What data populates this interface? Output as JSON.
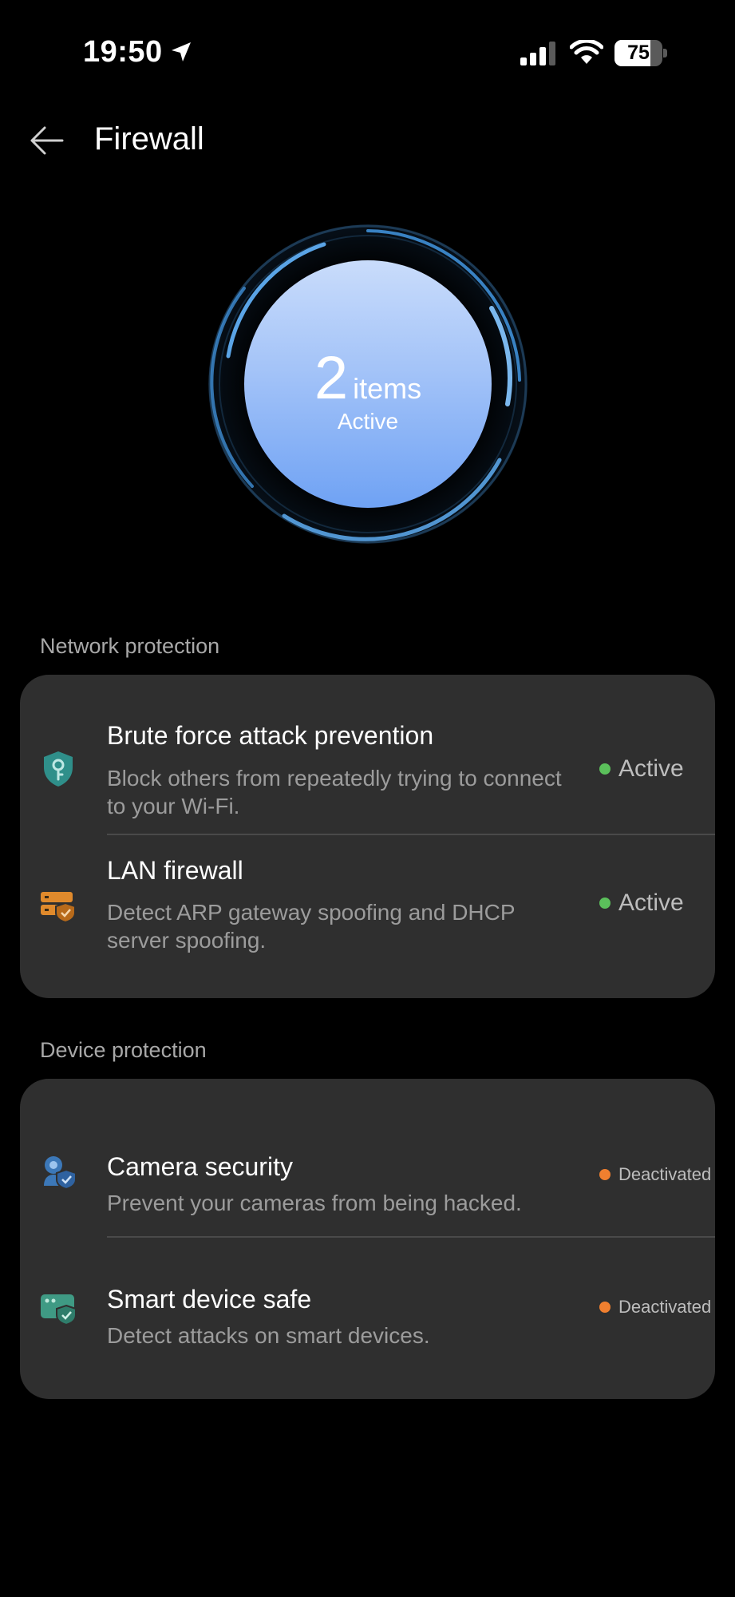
{
  "status_bar": {
    "time": "19:50",
    "battery_level": "75",
    "battery_fraction": 0.75,
    "icons": [
      "location-arrow-icon",
      "cellular-signal-icon",
      "wifi-icon",
      "battery-icon"
    ]
  },
  "header": {
    "title": "Firewall",
    "back_icon": "back-arrow-icon"
  },
  "summary": {
    "count": "2",
    "unit": "items",
    "state": "Active"
  },
  "colors": {
    "card_bg": "#2f2f2f",
    "active_dot": "#5bc05b",
    "inactive_dot": "#f07f2f",
    "gauge_core_top": "#c9dcfb",
    "gauge_core_bottom": "#6fa2f4",
    "ring": "#5aa4e6"
  },
  "sections": {
    "network": {
      "label": "Network protection",
      "items": [
        {
          "title": "Brute force attack prevention",
          "description": "Block others from repeatedly trying to connect to your Wi-Fi.",
          "status": "Active",
          "icon": "shield-key-icon"
        },
        {
          "title": "LAN firewall",
          "description": "Detect ARP gateway spoofing and DHCP server spoofing.",
          "status": "Active",
          "icon": "server-shield-icon"
        }
      ]
    },
    "device": {
      "label": "Device protection",
      "items": [
        {
          "title": "Camera security",
          "description": "Prevent your cameras from being hacked.",
          "status": "Deactivated",
          "icon": "camera-shield-icon"
        },
        {
          "title": "Smart device safe",
          "description": "Detect attacks on smart devices.",
          "status": "Deactivated",
          "icon": "smart-device-shield-icon"
        }
      ]
    }
  }
}
